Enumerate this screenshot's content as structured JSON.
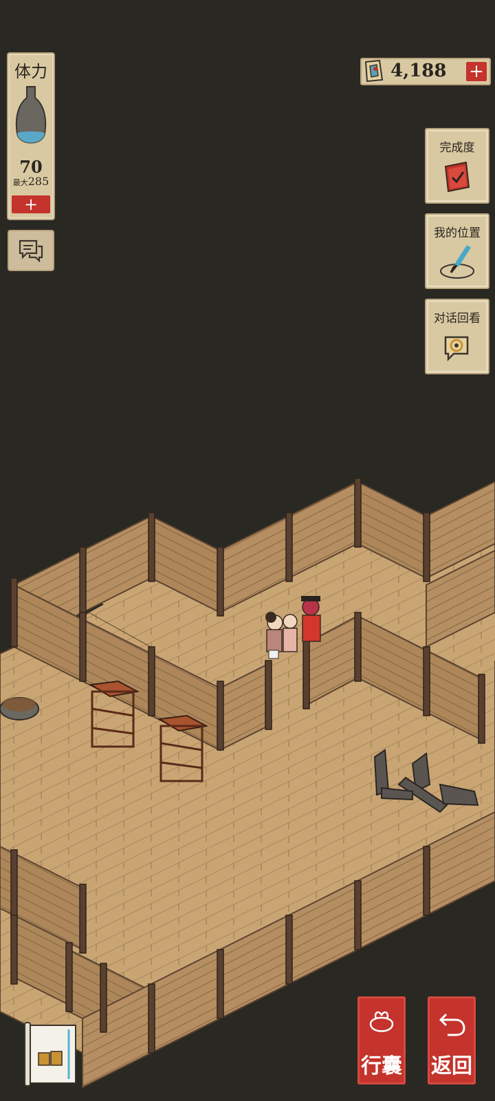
{
  "stamina": {
    "label": "体力",
    "value": "70",
    "max_label": "最大",
    "max_value": "285",
    "plus": "+",
    "fill_fraction": 0.25
  },
  "currency": {
    "amount": "4,188",
    "plus": "+"
  },
  "side_menu": {
    "completion": "完成度",
    "my_location": "我的位置",
    "dialogue_review": "对话回看"
  },
  "bottom": {
    "bag": "行囊",
    "back": "返回"
  },
  "colors": {
    "accent_red": "#c4332c",
    "panel": "#d9c9a2",
    "background": "#2a2823",
    "floor": "#c9a574"
  }
}
